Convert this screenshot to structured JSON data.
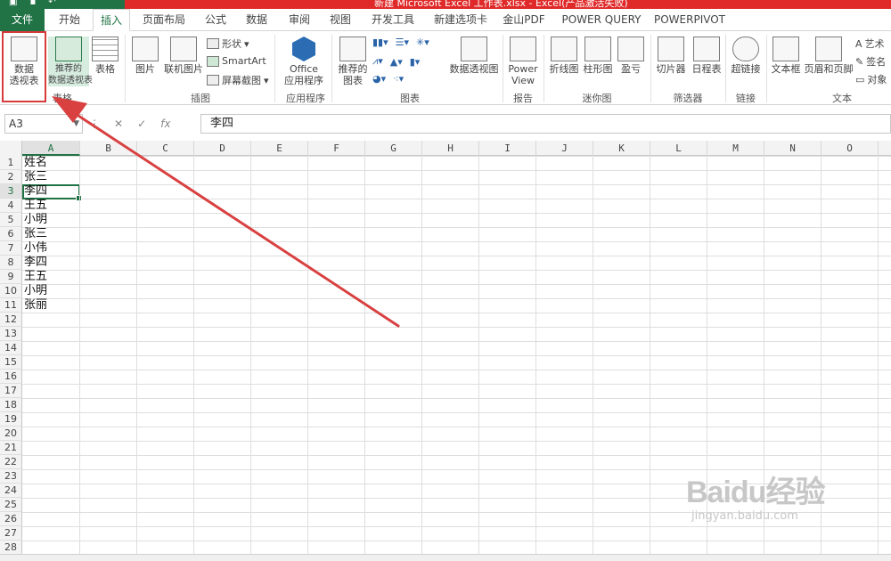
{
  "titlebar": {
    "title": "新建 Microsoft Excel 工作表.xlsx - Excel(产品激活失败)"
  },
  "tabs": [
    {
      "label": "文件"
    },
    {
      "label": "开始"
    },
    {
      "label": "插入"
    },
    {
      "label": "页面布局"
    },
    {
      "label": "公式"
    },
    {
      "label": "数据"
    },
    {
      "label": "审阅"
    },
    {
      "label": "视图"
    },
    {
      "label": "开发工具"
    },
    {
      "label": "新建选项卡"
    },
    {
      "label": "金山PDF"
    },
    {
      "label": "POWER QUERY"
    },
    {
      "label": "POWERPIVOT"
    }
  ],
  "ribbon": {
    "pivot_table": "数据\n透视表",
    "recommended_pivot": "推荐的\n数据透视表",
    "table": "表格",
    "group_tables": "表格",
    "pictures": "图片",
    "online_pictures": "联机图片",
    "shapes": "形状",
    "smartart": "SmartArt",
    "screenshot": "屏幕截图",
    "group_illustrations": "插图",
    "office_apps": "Office\n应用程序",
    "group_apps": "应用程序",
    "recommended_charts": "推荐的\n图表",
    "pivot_chart": "数据透视图",
    "group_charts": "图表",
    "power_view": "Power\nView",
    "group_reports": "报告",
    "spark_line": "折线图",
    "spark_column": "柱形图",
    "spark_winloss": "盈亏",
    "group_sparklines": "迷你图",
    "slicer": "切片器",
    "timeline": "日程表",
    "group_filters": "筛选器",
    "hyperlink": "超链接",
    "group_links": "链接",
    "textbox": "文本框",
    "header_footer": "页眉和页脚",
    "wordart": "艺术",
    "signature": "签名",
    "object": "对象",
    "group_text": "文本"
  },
  "formula_bar": {
    "name_box": "A3",
    "fx": "fx",
    "content": "李四"
  },
  "columns": [
    "A",
    "B",
    "C",
    "D",
    "E",
    "F",
    "G",
    "H",
    "I",
    "J",
    "K",
    "L",
    "M",
    "N",
    "O"
  ],
  "rows": [
    "1",
    "2",
    "3",
    "4",
    "5",
    "6",
    "7",
    "8",
    "9",
    "10",
    "11",
    "12",
    "13",
    "14",
    "15",
    "16",
    "17",
    "18",
    "19",
    "20",
    "21",
    "22",
    "23",
    "24",
    "25",
    "26",
    "27",
    "28"
  ],
  "cells_a": [
    "姓名",
    "张三",
    "李四",
    "王五",
    "小明",
    "张三",
    "小伟",
    "李四",
    "王五",
    "小明",
    "张丽"
  ],
  "watermark": {
    "brand": "Baidu经验",
    "url": "jingyan.baidu.com"
  },
  "colors": {
    "excel_green": "#217346",
    "highlight_red": "#d73a3a",
    "arrow_red": "#d94040"
  }
}
